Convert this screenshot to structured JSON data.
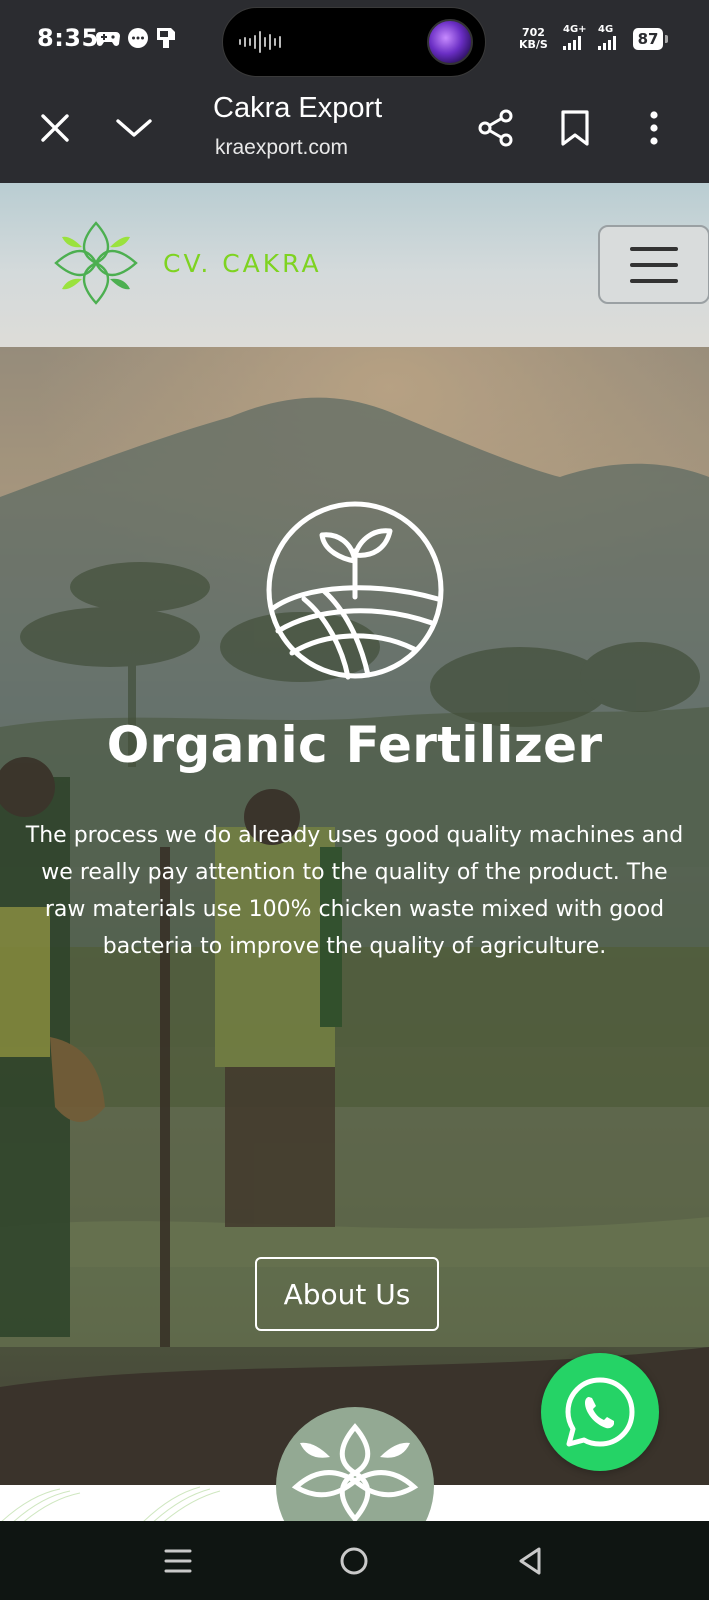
{
  "status_bar": {
    "time": "8:35",
    "net_speed_value": "702",
    "net_speed_unit": "KB/S",
    "sim1_type": "4G+",
    "sim2_type": "4G",
    "battery": "87"
  },
  "browser": {
    "title": "Cakra Export",
    "url": "kraexport.com"
  },
  "site": {
    "brand": "CV. CAKRA",
    "brand_color": "#7ed321",
    "hero": {
      "title": "Organic Fertilizer",
      "description": "The process we do already uses good quality machines and we really pay attention to the quality of the product. The raw materials use 100% chicken waste mixed with good bacteria to improve the quality of agriculture.",
      "button_label": "About Us"
    },
    "whatsapp_color": "#25d366"
  },
  "icons": {
    "close": "close-icon",
    "tabs": "chevron-down-icon",
    "share": "share-icon",
    "bookmark": "bookmark-icon",
    "more": "more-vertical-icon",
    "menu": "hamburger-icon",
    "plant": "sprout-field-icon",
    "whatsapp": "whatsapp-icon",
    "nav_recents": "recents-icon",
    "nav_home": "home-icon",
    "nav_back": "back-icon"
  }
}
